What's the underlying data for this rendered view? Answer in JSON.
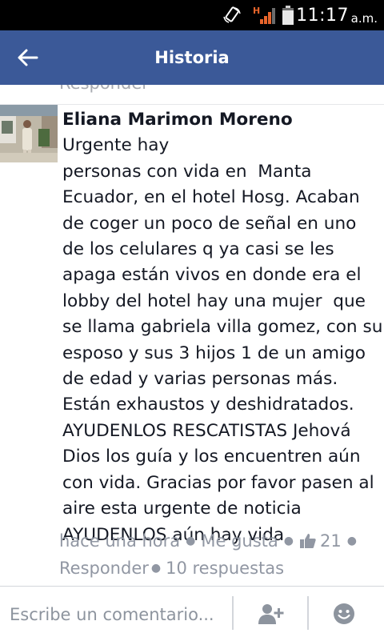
{
  "status_bar": {
    "time": "11:17",
    "ampm": "a.m.",
    "network_label": "H",
    "icons": [
      "screen-rotation-icon",
      "signal-icon",
      "battery-icon"
    ]
  },
  "header": {
    "title": "Historia",
    "back_icon": "arrow-left-icon",
    "background_color": "#3b5998"
  },
  "previous_comment": {
    "reply_label": "Responder"
  },
  "comment": {
    "author": "Eliana Marimon Moreno",
    "text_lines": [
      "Urgente hay",
      "personas con vida en  Manta",
      "Ecuador, en el hotel Hosg. Acaban",
      "de coger un poco de señal en uno",
      "de los celulares q ya casi se les",
      "apaga están vivos en donde era el",
      "lobby del hotel hay una mujer  que",
      "se llama gabriela villa gomez, con su",
      "esposo y sus 3 hijos 1 de un amigo",
      "de edad y varias personas más.",
      "Están exhaustos y deshidratados.",
      "AYUDENLOS RESCATISTAS Jehová",
      "Dios los guía y los encuentren aún",
      "con vida. Gracias por favor pasen al",
      "aire esta urgente de noticia",
      "AYUDENLOS aún hay vida."
    ],
    "timestamp": "hace una hora",
    "like_label": "Me gusta",
    "like_count": "21",
    "reply_label": "Responder",
    "replies_label": "10 respuestas"
  },
  "composer": {
    "placeholder": "Escribe un comentario...",
    "icons": [
      "add-person-icon",
      "smiley-icon"
    ]
  }
}
